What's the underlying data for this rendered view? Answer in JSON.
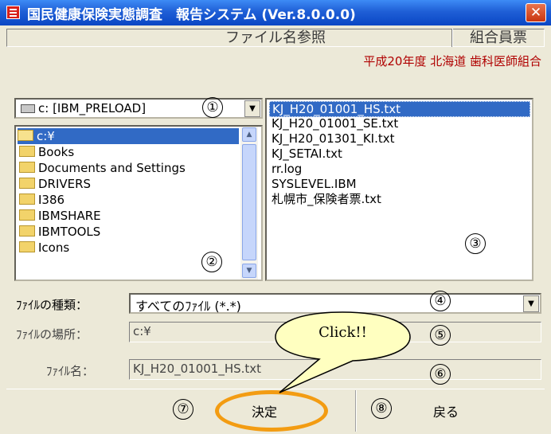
{
  "window": {
    "title": "国民健康保険実態調査　報告システム (Ver.8.0.0.0)",
    "close_symbol": "✕"
  },
  "header": {
    "dialog_title": "ファイル名参照",
    "right_label": "組合員票",
    "org_info": "平成20年度 北海道 歯科医師組合"
  },
  "drive": {
    "selected": "c: [IBM_PRELOAD]",
    "icon": "drive-icon"
  },
  "directories": [
    {
      "label": "c:¥",
      "selected": true
    },
    {
      "label": "Books"
    },
    {
      "label": "Documents and Settings"
    },
    {
      "label": "DRIVERS"
    },
    {
      "label": "I386"
    },
    {
      "label": "IBMSHARE"
    },
    {
      "label": "IBMTOOLS"
    },
    {
      "label": "Icons"
    }
  ],
  "files": [
    {
      "label": "KJ_H20_01001_HS.txt",
      "selected": true
    },
    {
      "label": "KJ_H20_01001_SE.txt"
    },
    {
      "label": "KJ_H20_01301_KI.txt"
    },
    {
      "label": "KJ_SETAI.txt"
    },
    {
      "label": "rr.log"
    },
    {
      "label": "SYSLEVEL.IBM"
    },
    {
      "label": "札幌市_保険者票.txt"
    }
  ],
  "fields": {
    "type_label": "ﾌｧｲﾙの種類：",
    "type_value": "すべてのﾌｧｲﾙ (*.*)",
    "location_label": "ﾌｧｲﾙの場所：",
    "location_value": "c:¥",
    "name_label": "ﾌｧｲﾙ名：",
    "name_value": "KJ_H20_01001_HS.txt"
  },
  "buttons": {
    "ok": "決定",
    "back": "戻る"
  },
  "markers": [
    "①",
    "②",
    "③",
    "④",
    "⑤",
    "⑥",
    "⑦",
    "⑧"
  ],
  "callout": "Click!!",
  "colors": {
    "title_bar": "#1f5fd6",
    "selection": "#316ac5",
    "org_text": "#b00000",
    "callout_fill": "#ffffc0",
    "highlight_ring": "#f39c12"
  }
}
